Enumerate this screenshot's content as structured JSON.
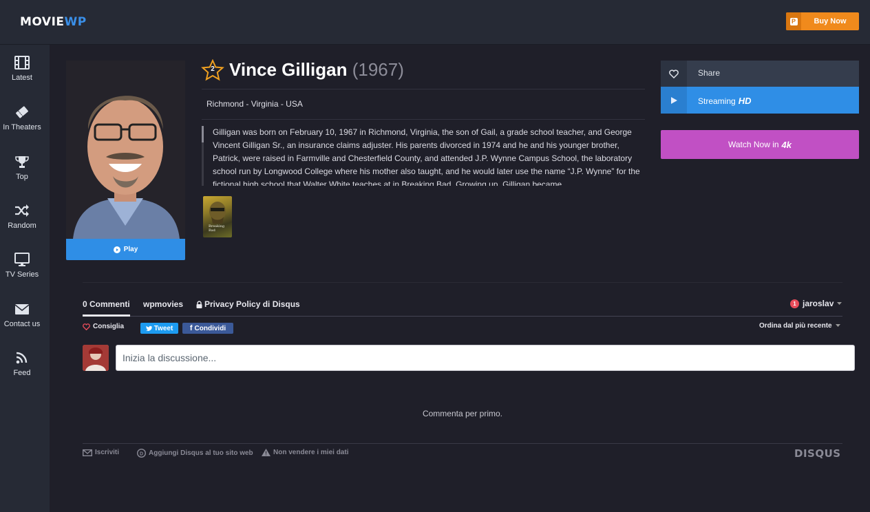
{
  "header": {
    "logo_main": "MOVIE",
    "logo_accent": "WP",
    "buy_label": "Buy Now",
    "buy_icon": "paypal-icon"
  },
  "sidebar": {
    "items": [
      {
        "label": "Latest",
        "icon": "film-icon"
      },
      {
        "label": "In Theaters",
        "icon": "ticket-icon"
      },
      {
        "label": "Top",
        "icon": "trophy-icon"
      },
      {
        "label": "Random",
        "icon": "shuffle-icon"
      },
      {
        "label": "TV Series",
        "icon": "tv-icon"
      },
      {
        "label": "Contact us",
        "icon": "envelope-icon"
      },
      {
        "label": "Feed",
        "icon": "rss-icon"
      }
    ]
  },
  "person": {
    "rank": "2",
    "name": "Vince Gilligan",
    "year": "(1967)",
    "location": "Richmond - Virginia - USA",
    "bio": "Gilligan was born on February 10, 1967 in Richmond, Virginia, the son of Gail, a grade school teacher, and George Vincent Gilligan Sr., an insurance claims adjuster. His parents divorced in 1974 and he and his younger brother, Patrick, were raised in Farmville and Chesterfield County, and attended J.P. Wynne Campus School, the laboratory school run by Longwood College where his mother also taught, and he would later use the name “J.P. Wynne” for the fictional high school that Walter White teaches at in Breaking Bad. Growing up, Gilligan became",
    "play_label": "Play",
    "credit_poster_text": "Breaking Bad"
  },
  "actions": {
    "share_label": "Share",
    "streaming_label": "Streaming",
    "streaming_quality": "HD",
    "watch_label": "Watch Now in",
    "watch_quality": "4k"
  },
  "disqus": {
    "tabs": [
      "0 Commenti",
      "wpmovies",
      "Privacy Policy di Disqus"
    ],
    "user": "jaroslav",
    "notification_count": "1",
    "recommend_label": "Consiglia",
    "tweet_label": "Tweet",
    "share_label": "Condividi",
    "sort_label": "Ordina dal più recente",
    "input_placeholder": "Inizia la discussione...",
    "empty_message": "Commenta per primo.",
    "footer_subscribe": "Iscriviti",
    "footer_add": "Aggiungi Disqus al tuo sito web",
    "footer_privacy": "Non vendere i miei dati",
    "brand": "DISQUS"
  },
  "colors": {
    "accent_blue": "#2f8ee6",
    "accent_orange": "#f08a1c",
    "accent_purple": "#c150c4",
    "background": "#1f1f29"
  }
}
